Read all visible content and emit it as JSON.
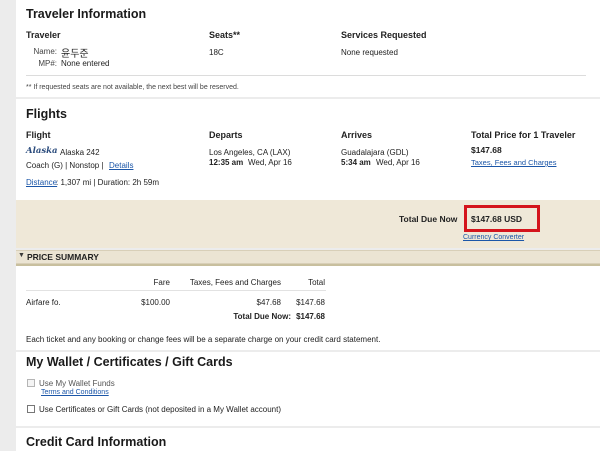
{
  "traveler": {
    "title": "Traveler Information",
    "col_traveler": "Traveler",
    "col_seats": "Seats**",
    "col_services": "Services Requested",
    "name_label": "Name:",
    "name_value": "윤두준",
    "mp_label": "MP#:",
    "mp_value": "None entered",
    "seat": "18C",
    "services": "None requested",
    "note": "** If requested seats are not available, the next best will be reserved."
  },
  "flights": {
    "title": "Flights",
    "col_flight": "Flight",
    "col_departs": "Departs",
    "col_arrives": "Arrives",
    "col_total": "Total Price for 1 Traveler",
    "airline_logo": "Alaska",
    "flight_name": "Alaska 242",
    "cabin": "Coach (G) | Nonstop |",
    "details_link": "Details",
    "depart_city": "Los Angeles, CA (LAX)",
    "depart_time": "12:35 am",
    "depart_date": "Wed, Apr 16",
    "arrive_city": "Guadalajara (GDL)",
    "arrive_time": "5:34 am",
    "arrive_date": "Wed, Apr 16",
    "price": "$147.68",
    "taxes_link": "Taxes, Fees and Charges",
    "distance_link": "Distance",
    "distance_rest": ": 1,307 mi | Duration: 2h 59m"
  },
  "total_due": {
    "label": "Total Due Now",
    "amount": "$147.68 USD",
    "converter_link": "Currency Converter",
    "highlight_color": "#d4141c"
  },
  "price_summary": {
    "title": "PRICE SUMMARY",
    "col_fare": "Fare",
    "col_taxes": "Taxes, Fees and Charges",
    "col_total": "Total",
    "row_label": "Airfare fo.",
    "row_fare": "$100.00",
    "row_taxes": "$47.68",
    "row_total": "$147.68",
    "total_label": "Total Due Now:",
    "total_value": "$147.68",
    "note": "Each ticket and any booking or change fees will be a separate charge on your credit card statement."
  },
  "wallet": {
    "title": "My Wallet / Certificates / Gift Cards",
    "option1": "Use My Wallet Funds",
    "terms_link": "Terms and Conditions",
    "option2": "Use Certificates or Gift Cards (not deposited in a My Wallet account)"
  },
  "credit_card": {
    "title": "Credit Card Information"
  }
}
